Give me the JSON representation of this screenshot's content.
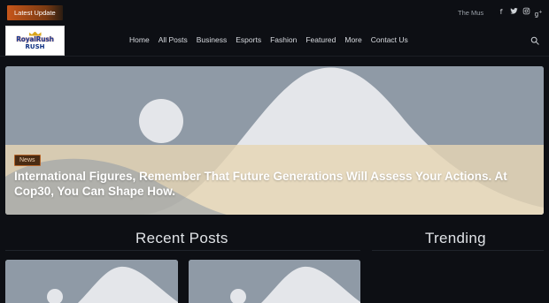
{
  "topbar": {
    "latest_label": "Latest Update",
    "ticker_text": "The Mus",
    "social_icons": [
      "facebook-icon",
      "twitter-icon",
      "instagram-icon",
      "google-plus-icon"
    ]
  },
  "header": {
    "logo_line1": "RoyalRush",
    "logo_line2": "RUSH",
    "nav": [
      "Home",
      "All Posts",
      "Business",
      "Esports",
      "Fashion",
      "Featured",
      "More",
      "Contact Us"
    ]
  },
  "hero": {
    "category": "News",
    "title": "International Figures, Remember That Future Generations Will Assess Your Actions. At Cop30, You Can Shape How."
  },
  "sections": {
    "recent_title": "Recent Posts",
    "trending_title": "Trending"
  },
  "colors": {
    "accent": "#c7561a",
    "background": "#0d0f14",
    "placeholder_sky": "#8f9aa6",
    "placeholder_hill": "#e4e6ea",
    "placeholder_sand": "#e6d5b4"
  }
}
